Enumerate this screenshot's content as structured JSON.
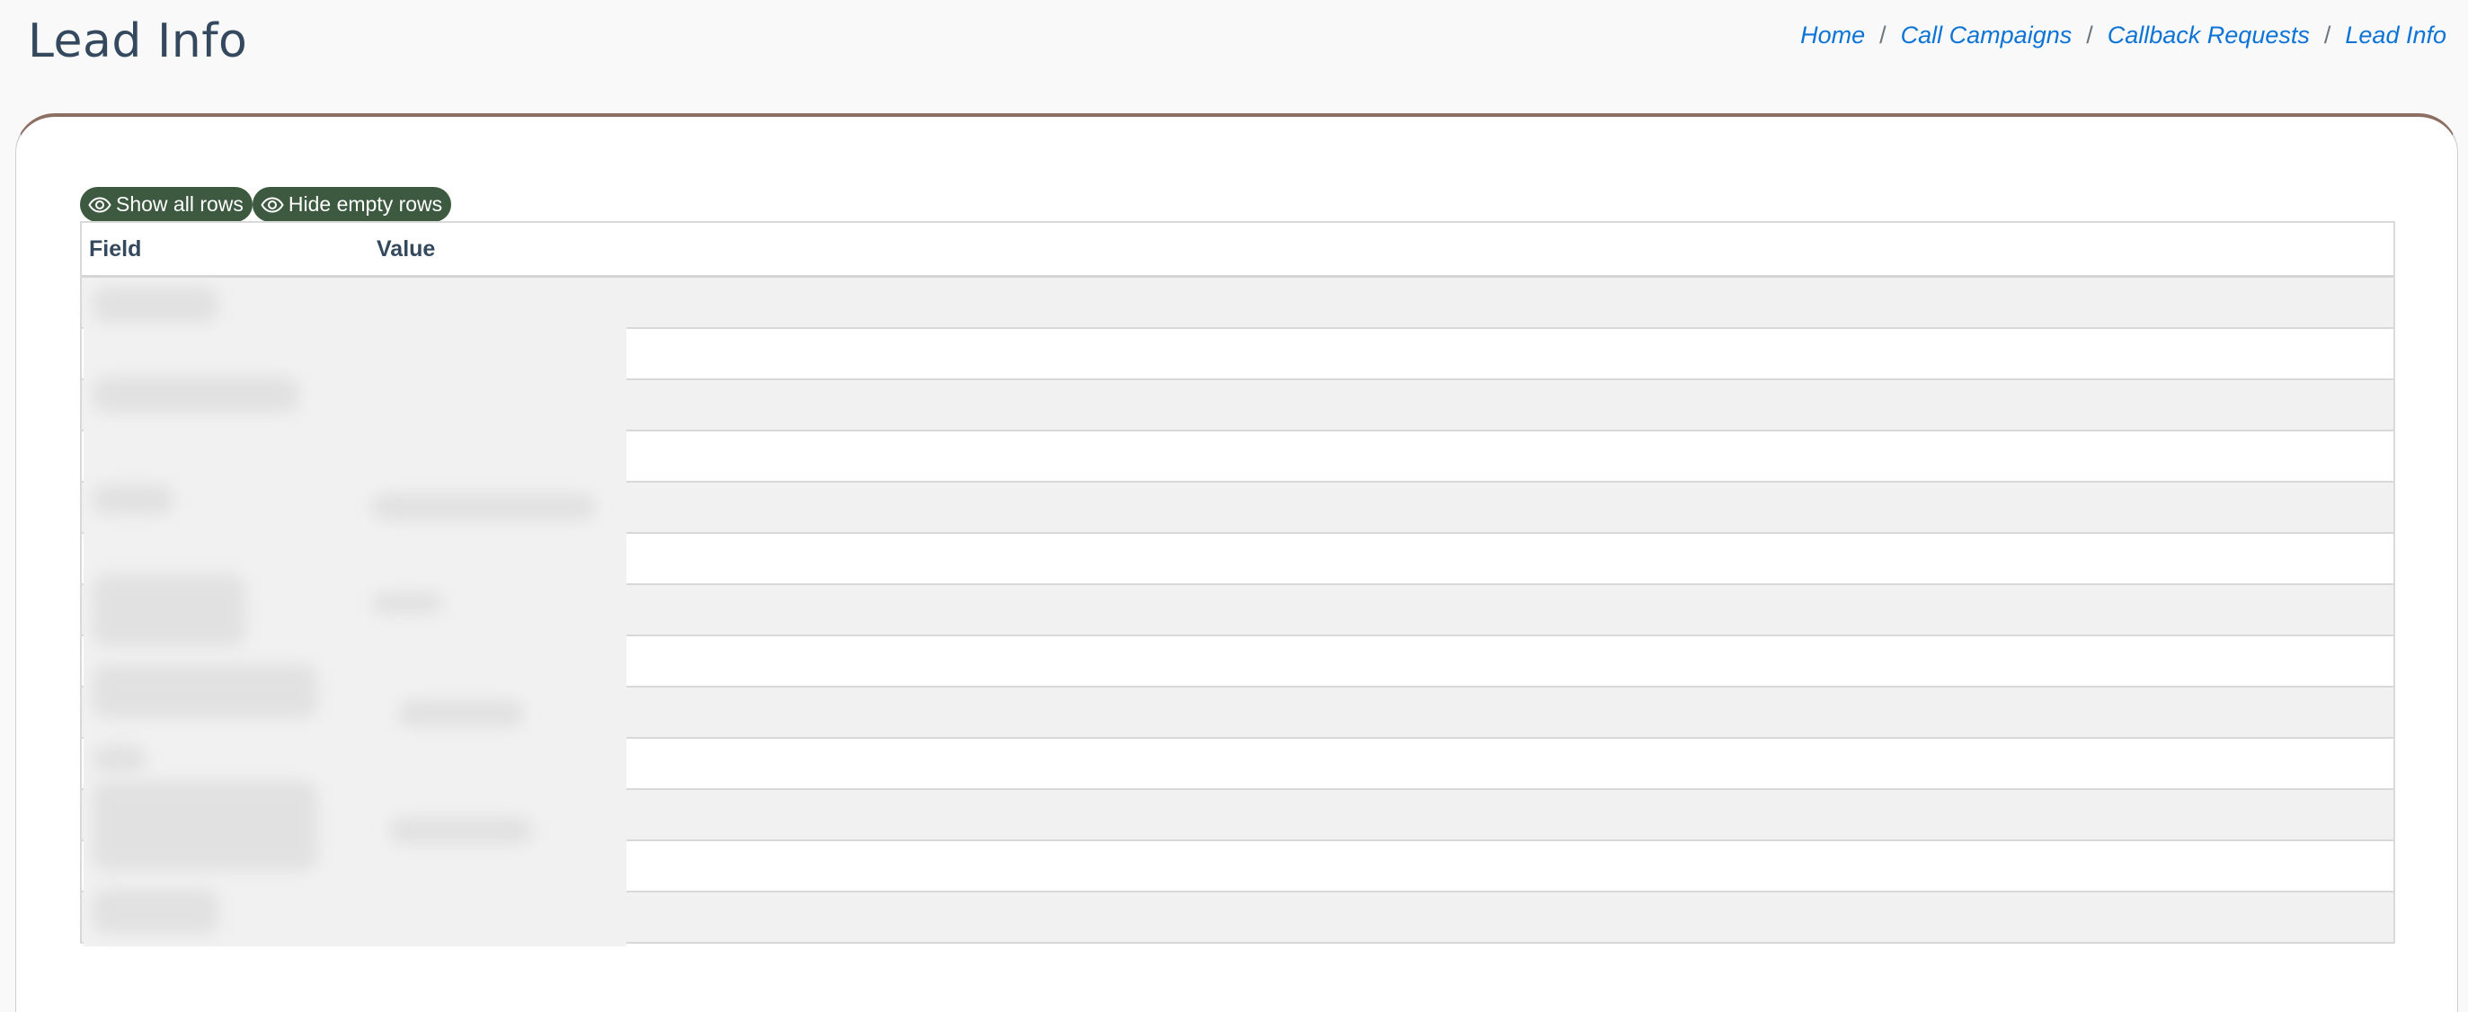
{
  "header": {
    "title": "Lead Info"
  },
  "breadcrumb": {
    "items": [
      {
        "label": "Home"
      },
      {
        "label": "Call Campaigns"
      },
      {
        "label": "Callback Requests"
      },
      {
        "label": "Lead Info"
      }
    ],
    "separator": "/"
  },
  "toolbar": {
    "show_all_label": "Show all rows",
    "hide_empty_label": "Hide empty rows",
    "button_icon": "eye-icon",
    "button_color": "#3d5a40"
  },
  "table": {
    "columns": [
      "Field",
      "Value"
    ],
    "row_count": 13,
    "rows_redacted": true
  },
  "colors": {
    "title": "#34495e",
    "link": "#0d74d6",
    "card_accent": "#8d6e63",
    "row_stripe": "#f1f1f1"
  }
}
